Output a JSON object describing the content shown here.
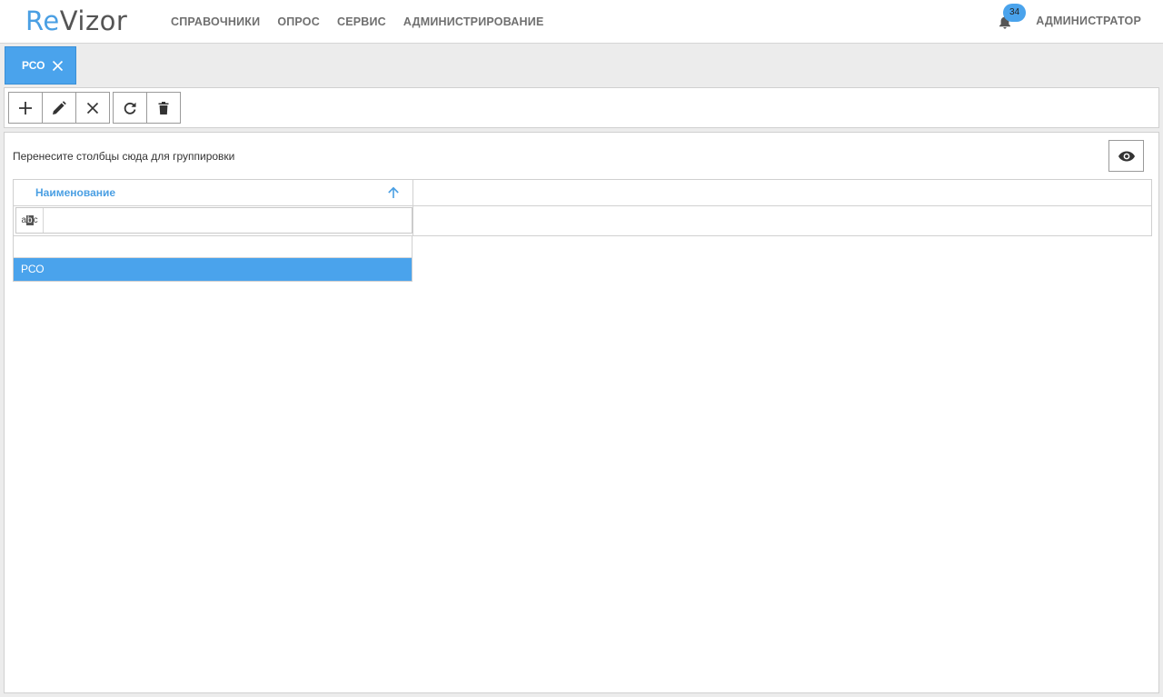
{
  "header": {
    "logo_part1": "Re",
    "logo_part2": "Vizor",
    "nav": [
      "СПРАВОЧНИКИ",
      "ОПРОС",
      "СЕРВИС",
      "АДМИНИСТРИРОВАНИЕ"
    ],
    "notifications_count": "34",
    "user_label": "АДМИНИСТРАТОР"
  },
  "tabs": [
    {
      "label": "РСО",
      "icon": "close-icon"
    }
  ],
  "toolbar": {
    "buttons": [
      "plus-icon",
      "pencil-icon",
      "close-icon",
      "refresh-icon",
      "trash-icon"
    ]
  },
  "grid": {
    "group_hint": "Перенесите столбцы сюда для группировки",
    "column_header": "Наименование",
    "sort": "ascending",
    "filter_operator": "abc",
    "filter_value": "",
    "rows": [
      {
        "name": "РСО",
        "selected": true
      }
    ]
  },
  "colors": {
    "accent": "#4aa3ec",
    "logo_blue": "#4a9fe3",
    "nav_gray": "#6f6f6f"
  }
}
